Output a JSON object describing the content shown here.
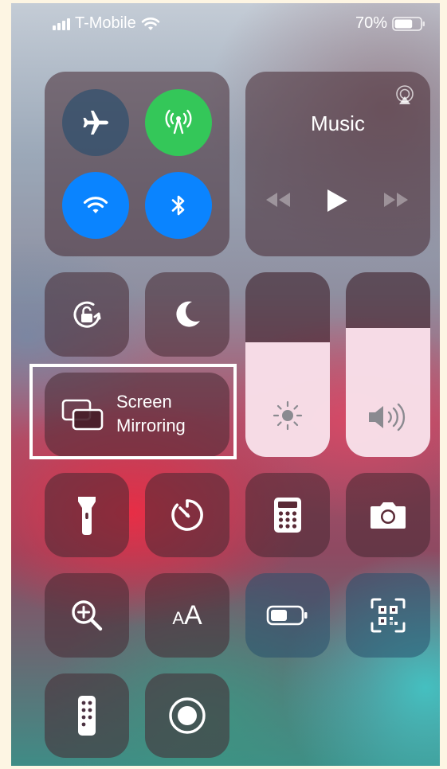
{
  "status_bar": {
    "carrier": "T-Mobile",
    "battery_percent": "70%",
    "battery_level": 0.7,
    "signal_bars": 4
  },
  "connectivity": {
    "airplane_mode": {
      "icon": "airplane-icon",
      "active": false
    },
    "cellular_data": {
      "icon": "cellular-antenna-icon",
      "active": true,
      "color": "#34c759"
    },
    "wifi": {
      "icon": "wifi-icon",
      "active": true,
      "color": "#0a84ff"
    },
    "bluetooth": {
      "icon": "bluetooth-icon",
      "active": true,
      "color": "#0a84ff"
    }
  },
  "music": {
    "title": "Music",
    "airplay_icon": "airplay-icon",
    "controls": [
      "rewind-icon",
      "play-icon",
      "fast-forward-icon"
    ]
  },
  "toggles": {
    "orientation_lock": {
      "icon": "orientation-lock-icon"
    },
    "do_not_disturb": {
      "icon": "moon-icon"
    }
  },
  "screen_mirroring": {
    "line1": "Screen",
    "line2": "Mirroring",
    "icon": "screen-mirroring-icon",
    "highlighted": true
  },
  "sliders": {
    "brightness": {
      "icon": "sun-icon",
      "level": 0.62
    },
    "volume": {
      "icon": "speaker-icon",
      "level": 0.7
    }
  },
  "shortcuts_row1": [
    "flashlight-icon",
    "timer-icon",
    "calculator-icon",
    "camera-icon"
  ],
  "shortcuts_row2": [
    "magnifier-icon",
    "text-size-icon",
    "low-power-mode-icon",
    "qr-code-scanner-icon"
  ],
  "shortcuts_row3": [
    "apple-tv-remote-icon",
    "screen-recording-icon"
  ],
  "text_size_glyph": {
    "small": "A",
    "large": "A"
  },
  "colors": {
    "highlight_border": "#ffffff",
    "active_green": "#34c759",
    "active_blue": "#0a84ff"
  }
}
